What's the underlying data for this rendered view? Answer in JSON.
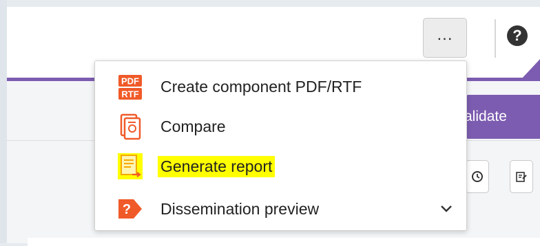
{
  "toolbar": {
    "more_button_label": "...",
    "help_icon_label": "?"
  },
  "actions": {
    "validate_label": "alidate"
  },
  "menu": {
    "items": [
      {
        "label": "Create component PDF/RTF",
        "icon": "pdf-rtf-icon",
        "icon_text_top": "PDF",
        "icon_text_bottom": "RTF"
      },
      {
        "label": "Compare",
        "icon": "compare-icon"
      },
      {
        "label": "Generate report",
        "icon": "report-icon",
        "highlighted": true
      },
      {
        "label": "Dissemination preview",
        "icon": "dissemination-icon",
        "icon_text": "?",
        "has_submenu": true
      }
    ]
  },
  "colors": {
    "accent": "#7c5cb0",
    "icon_orange": "#f05a28",
    "highlight": "#ffff00",
    "report_icon": "#f5c400"
  }
}
